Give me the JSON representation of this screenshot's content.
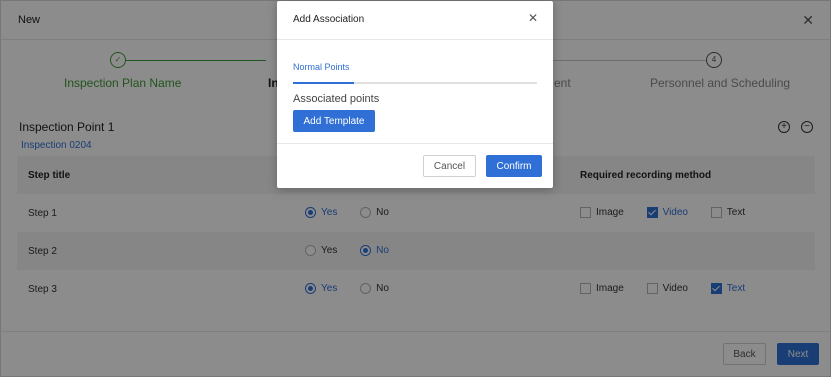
{
  "window": {
    "title": "New",
    "close_icon": "close-icon"
  },
  "steps": [
    {
      "number": "",
      "label": "Inspection Plan Name",
      "state": "done"
    },
    {
      "number": "",
      "label": "In",
      "state": "active"
    },
    {
      "number": "",
      "label": "ent",
      "state": "todo"
    },
    {
      "number": "4",
      "label": "Personnel and Scheduling",
      "state": "todo"
    }
  ],
  "section": {
    "title": "Inspection Point 1",
    "subtitle": "Inspection 0204"
  },
  "table": {
    "headers": {
      "step_title": "Step title",
      "required": "Required recording method"
    },
    "rows": [
      {
        "title": "Step 1",
        "yes": "Yes",
        "no": "No",
        "selected": "yes",
        "image": "Image",
        "video": "Video",
        "text": "Text",
        "checked": [
          "video"
        ]
      },
      {
        "title": "Step 2",
        "yes": "Yes",
        "no": "No",
        "selected": "no"
      },
      {
        "title": "Step 3",
        "yes": "Yes",
        "no": "No",
        "selected": "yes",
        "image": "Image",
        "video": "Video",
        "text": "Text",
        "checked": [
          "text"
        ]
      }
    ]
  },
  "footer": {
    "back": "Back",
    "next": "Next"
  },
  "modal": {
    "title": "Add Association",
    "tab": "Normal Points",
    "associated_label": "Associated points",
    "add_template": "Add Template",
    "cancel": "Cancel",
    "confirm": "Confirm"
  },
  "colors": {
    "accent": "#2f6fd6",
    "success": "#3f9c35"
  }
}
